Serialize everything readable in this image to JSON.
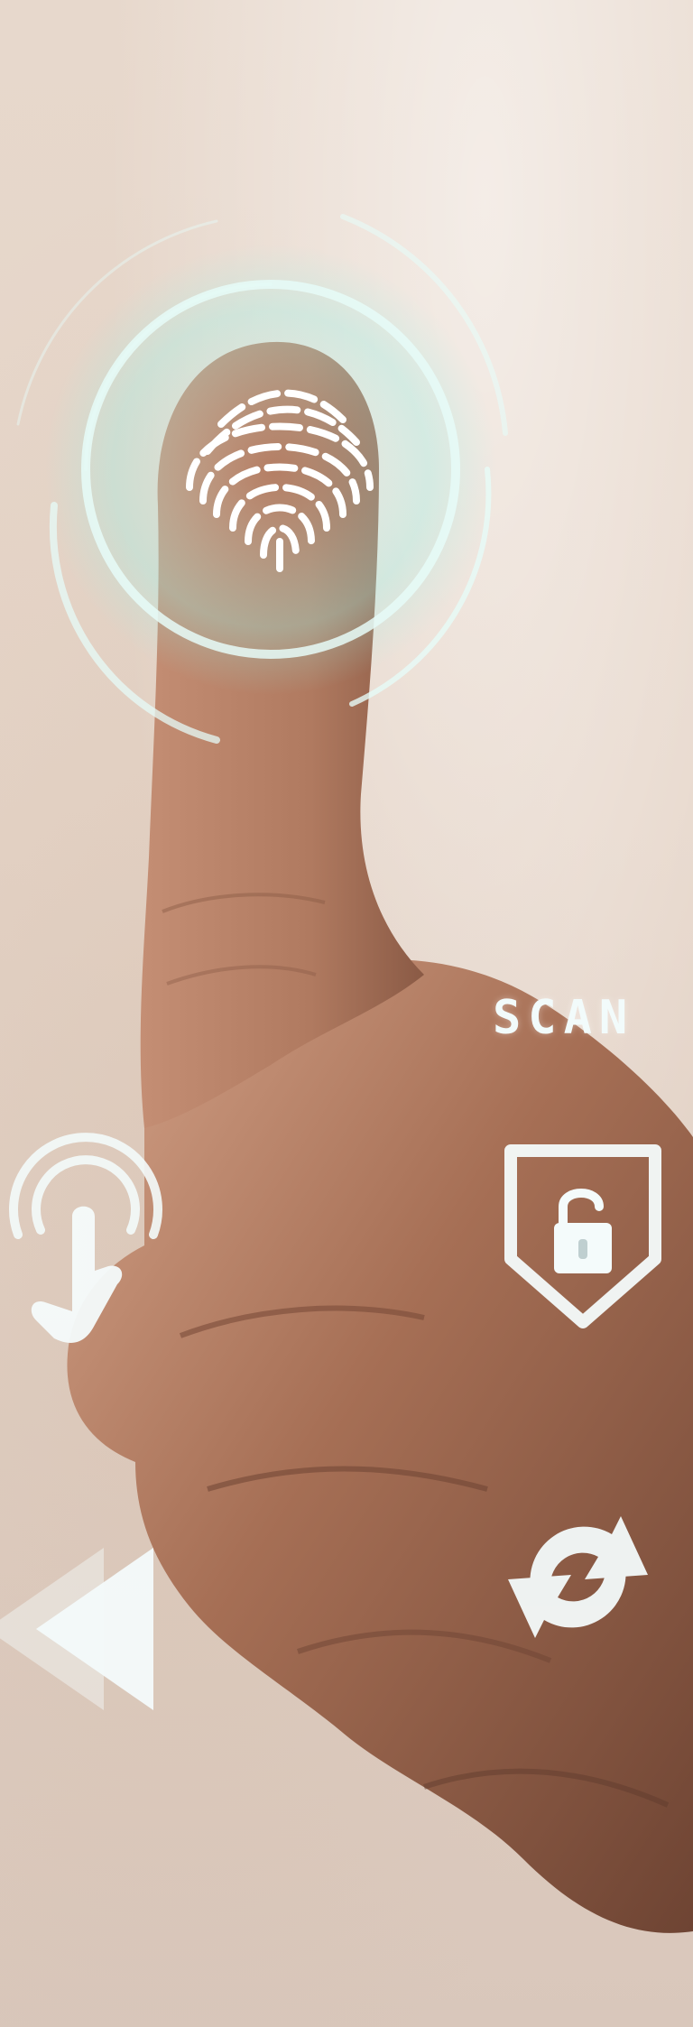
{
  "scan_label": "SCAN",
  "colors": {
    "accent_cyan": "#b9f2ee",
    "skin": "#a06a52",
    "background": "#e7d8cc",
    "icon_white": "#f2fbfb"
  },
  "icons": [
    "fingerprint-icon",
    "scan-rings-icon",
    "tap-icon",
    "lock-shield-icon",
    "refresh-icon",
    "rewind-icon"
  ]
}
